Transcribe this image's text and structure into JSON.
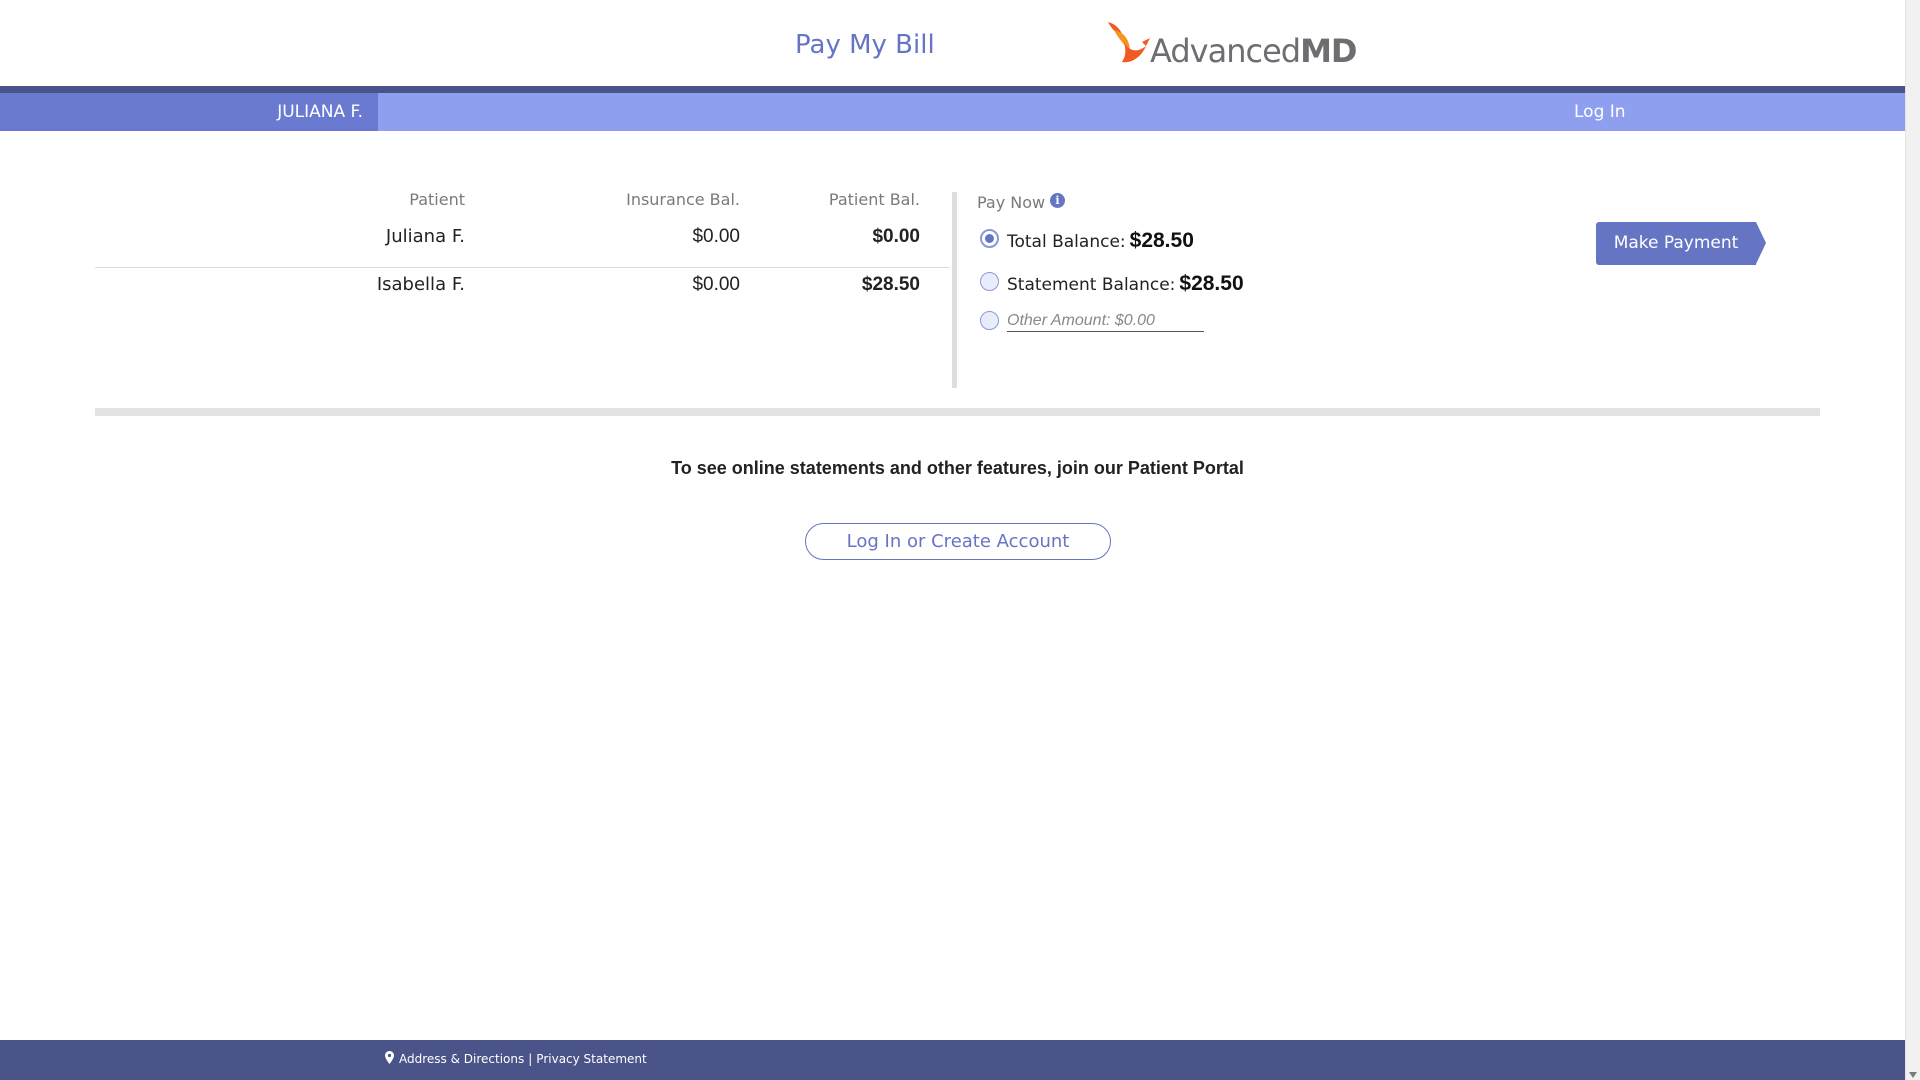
{
  "header": {
    "title": "Pay My Bill",
    "logo_text_light": "Advanced",
    "logo_text_bold": "MD"
  },
  "nav": {
    "user_name": "JULIANA F.",
    "login_label": "Log In"
  },
  "balance_table": {
    "columns": [
      "Patient",
      "Insurance Bal.",
      "Patient Bal."
    ],
    "rows": [
      {
        "patient": "Juliana F.",
        "insurance_bal": "$0.00",
        "patient_bal": "$0.00"
      },
      {
        "patient": "Isabella F.",
        "insurance_bal": "$0.00",
        "patient_bal": "$28.50"
      }
    ]
  },
  "pay_now": {
    "label": "Pay Now",
    "info_icon": "info-icon",
    "options": [
      {
        "label": "Total Balance:",
        "amount": "$28.50",
        "selected": true
      },
      {
        "label": "Statement Balance:",
        "amount": "$28.50",
        "selected": false
      },
      {
        "label": "Other Amount:",
        "placeholder": "Other Amount: $0.00",
        "selected": false
      }
    ],
    "make_payment_label": "Make Payment"
  },
  "portal": {
    "message": "To see online statements and other features, join our Patient Portal",
    "button_label": "Log In or Create Account"
  },
  "footer": {
    "address_link": "Address & Directions",
    "separator": "|",
    "privacy_link": "Privacy Statement"
  },
  "colors": {
    "accent": "#6674c4",
    "nav_bar": "#8f9ff0",
    "nav_user": "#6a7ad1",
    "dark_bar": "#4a5489",
    "logo_orange": "#f15a22"
  }
}
